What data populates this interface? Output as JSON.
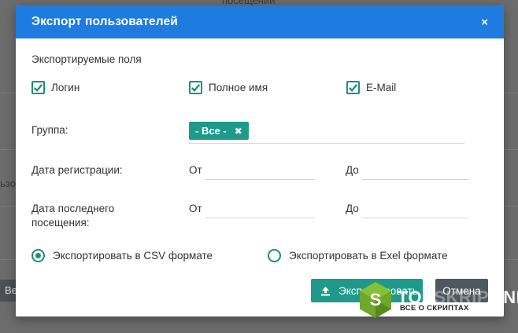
{
  "background": {
    "top_text": "посещении",
    "left_text": "ьзо",
    "left_button": "Ве"
  },
  "modal": {
    "title": "Экспорт пользователей",
    "close_symbol": "×",
    "fields_title": "Экспортируемые поля",
    "checkboxes": [
      {
        "label": "Логин",
        "checked": true
      },
      {
        "label": "Полное имя",
        "checked": true
      },
      {
        "label": "E-Mail",
        "checked": true
      }
    ],
    "group": {
      "label": "Группа:",
      "tag": "- Все -",
      "tag_remove": "✖"
    },
    "registration_date": {
      "label": "Дата регистрации:",
      "from_label": "От",
      "to_label": "До",
      "from_value": "",
      "to_value": ""
    },
    "last_visit_date": {
      "label_line1": "Дата последнего",
      "label_line2": "посещения:",
      "from_label": "От",
      "to_label": "До",
      "from_value": "",
      "to_value": ""
    },
    "format_options": [
      {
        "label": "Экспортировать в CSV формате",
        "selected": true
      },
      {
        "label": "Экспортировать в Exel формате",
        "selected": false
      }
    ],
    "export_button": "Экспортировать",
    "cancel_button": "Отмена"
  },
  "watermark": {
    "logo_letter": "S",
    "text_left": "TOP",
    "text_mid": "SKRIPT",
    "text_right": ".NET",
    "subtitle": "ВСЕ О СКРИПТАХ"
  },
  "colors": {
    "header": "#1e7be0",
    "accent": "#1f9a8a",
    "cancel": "#4d5860"
  }
}
